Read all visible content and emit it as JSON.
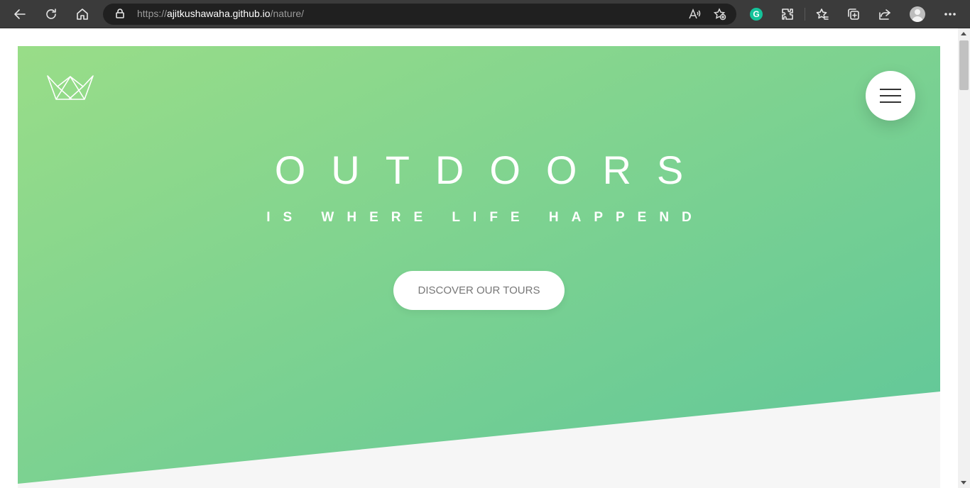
{
  "browser": {
    "url_prefix": "https://",
    "url_host": "ajitkushawaha.github.io",
    "url_path": "/nature/",
    "extension_grammarly_letter": "G",
    "icons": [
      "back-icon",
      "refresh-icon",
      "home-icon",
      "lock-icon",
      "read-aloud-icon",
      "add-favorite-icon",
      "grammarly-icon",
      "extensions-icon",
      "favorites-icon",
      "collections-icon",
      "share-icon",
      "profile-icon",
      "more-icon"
    ]
  },
  "hero": {
    "title": "OUTDOORS",
    "subtitle": "IS WHERE LIFE HAPPEND",
    "cta_label": "DISCOVER OUR TOURS",
    "logo": "crown-logo-icon",
    "menu": "hamburger-menu-icon"
  },
  "colors": {
    "gradient_start": "#99dd88",
    "gradient_end": "#5ec69a",
    "page_bg": "#f6f6f6",
    "toolbar_bg": "#3b3b3b"
  }
}
